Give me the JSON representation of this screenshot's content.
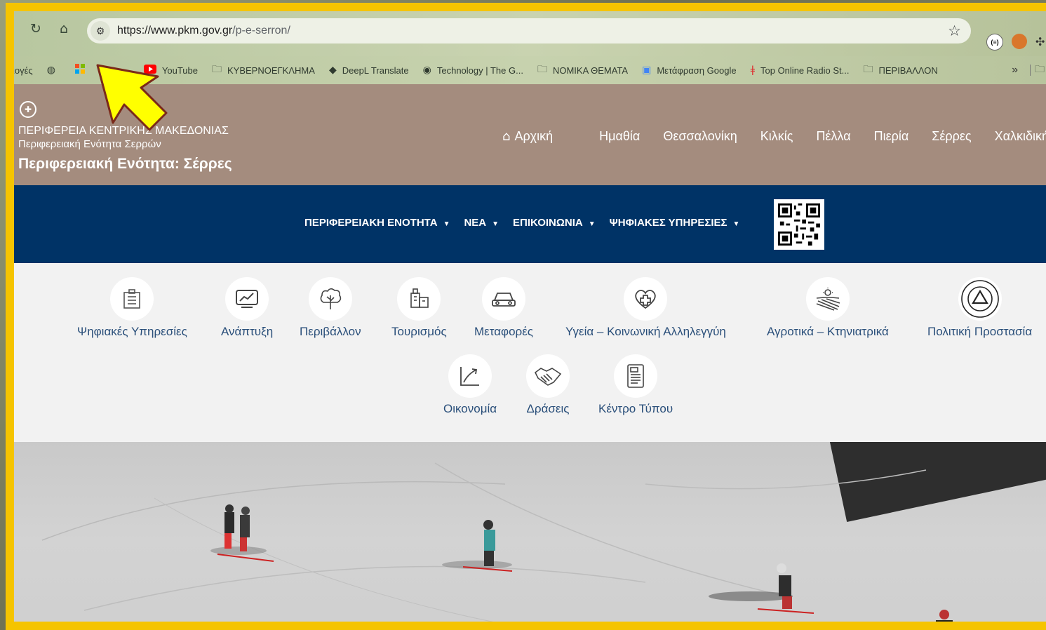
{
  "browser": {
    "url_host": "https://www.pkm.gov.gr",
    "url_path": "/p-e-serron/",
    "ext1_label": "(≡)",
    "bookmarks": [
      {
        "icon": "folder-icon",
        "label": "ιογές"
      },
      {
        "icon": "globe-icon",
        "label": ""
      },
      {
        "icon": "microsoft-icon",
        "label": ""
      },
      {
        "icon": "youtube-icon",
        "label": "YouTube"
      },
      {
        "icon": "folder-icon",
        "label": "ΚΥΒΕΡΝΟΕΓΚΛΗΜΑ"
      },
      {
        "icon": "deepl-icon",
        "label": "DeepL Translate"
      },
      {
        "icon": "verge-icon",
        "label": "Technology | The G..."
      },
      {
        "icon": "folder-icon",
        "label": "ΝΟΜΙΚΑ ΘΕΜΑΤΑ"
      },
      {
        "icon": "translate-icon",
        "label": "Μετάφραση Google"
      },
      {
        "icon": "radio-icon",
        "label": "Top Online Radio St..."
      },
      {
        "icon": "folder-icon",
        "label": "ΠΕΡΙΒΑΛΛΟΝ"
      }
    ],
    "more_label": "»"
  },
  "header": {
    "org_name": "ΠΕΡΙΦΕΡΕΙΑ ΚΕΝΤΡΙΚΗΣ ΜΑΚΕΔΟΝΙΑΣ",
    "org_sub": "Περιφερειακή Ενότητα Σερρών",
    "unit_title": "Περιφερειακή Ενότητα: Σέρρες",
    "nav": [
      "Αρχική",
      "Ημαθία",
      "Θεσσαλονίκη",
      "Κιλκίς",
      "Πέλλα",
      "Πιερία",
      "Σέρρες",
      "Χαλκιδική"
    ]
  },
  "menu": {
    "items": [
      "ΠΕΡΙΦΕΡΕΙΑΚΗ ΕΝΟΤΗΤΑ",
      "ΝΕΑ",
      "ΕΠΙΚΟΙΝΩΝΙΑ",
      "ΨΗΦΙΑΚΕΣ ΥΠΗΡΕΣΙΕΣ"
    ],
    "caret": "▼"
  },
  "categories": [
    {
      "label": "Ψηφιακές Υπηρεσίες",
      "icon": "digital-services-icon"
    },
    {
      "label": "Ανάπτυξη",
      "icon": "development-chart-icon"
    },
    {
      "label": "Περιβάλλον",
      "icon": "environment-tree-icon"
    },
    {
      "label": "Τουρισμός",
      "icon": "tourism-luggage-icon"
    },
    {
      "label": "Μεταφορές",
      "icon": "transport-car-icon"
    },
    {
      "label": "Υγεία – Κοινωνική Αλληλεγγύη",
      "icon": "health-heart-icon"
    },
    {
      "label": "Αγροτικά – Κτηνιατρικά",
      "icon": "agriculture-field-icon"
    },
    {
      "label": "Πολιτική Προστασία",
      "icon": "civil-protection-icon"
    },
    {
      "label": "Οικονομία",
      "icon": "economy-growth-icon"
    },
    {
      "label": "Δράσεις",
      "icon": "actions-handshake-icon"
    },
    {
      "label": "Κέντρο Τύπου",
      "icon": "press-news-icon"
    }
  ],
  "colors": {
    "frame": "#f5c400",
    "header_bg": "#a48c7e",
    "menu_bg": "#003366",
    "category_text": "#2a4f7a",
    "arrow": "#ffff00"
  }
}
